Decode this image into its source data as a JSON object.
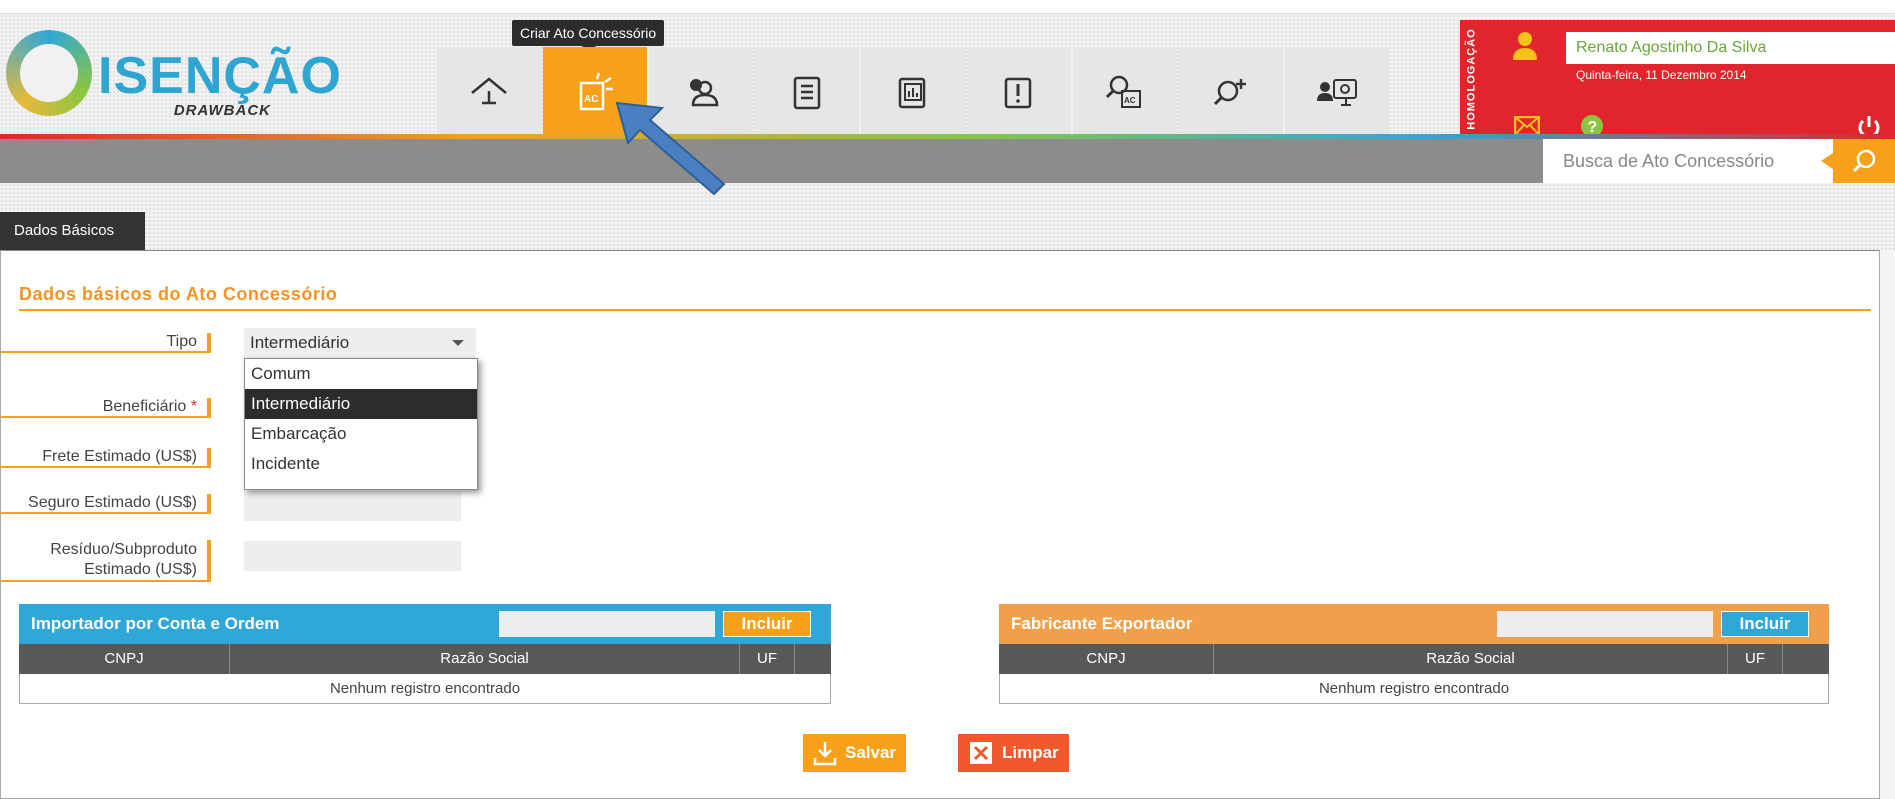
{
  "app": {
    "logo_title": "ISENÇÃO",
    "logo_sub": "DRAWBACK"
  },
  "nav": {
    "tooltip": "Criar Ato Concessório",
    "items": [
      {
        "icon": "home-icon"
      },
      {
        "icon": "criar-ato-icon",
        "active": true
      },
      {
        "icon": "users-icon"
      },
      {
        "icon": "clipboard-icon"
      },
      {
        "icon": "report-icon"
      },
      {
        "icon": "alert-doc-icon"
      },
      {
        "icon": "search-ac-icon"
      },
      {
        "icon": "search-plus-icon"
      },
      {
        "icon": "settings-user-icon"
      }
    ]
  },
  "env_badge": "HOMOLOGAÇÃO",
  "user": {
    "name": "Renato Agostinho Da Silva",
    "date": "Quinta-feira, 11 Dezembro 2014"
  },
  "search": {
    "placeholder": "Busca de Ato Concessório"
  },
  "tabs": [
    {
      "label": "Dados Básicos"
    }
  ],
  "form": {
    "section_title": "Dados básicos do Ato Concessório",
    "labels": {
      "tipo": "Tipo",
      "beneficiario": "Beneficiário",
      "beneficiario_required": "*",
      "frete": "Frete Estimado (US$)",
      "seguro": "Seguro Estimado (US$)",
      "residuo_line1": "Resíduo/Subproduto",
      "residuo_line2": "Estimado (US$)"
    },
    "tipo_selected": "Intermediário",
    "tipo_options": [
      "Comum",
      "Intermediário",
      "Embarcação",
      "Incidente"
    ]
  },
  "importador": {
    "title": "Importador por Conta e Ordem",
    "include_label": "Incluir",
    "columns": [
      "CNPJ",
      "Razão Social",
      "UF"
    ],
    "empty": "Nenhum registro encontrado"
  },
  "fabricante": {
    "title": "Fabricante Exportador",
    "include_label": "Incluir",
    "columns": [
      "CNPJ",
      "Razão Social",
      "UF"
    ],
    "empty": "Nenhum registro encontrado"
  },
  "actions": {
    "save_label": "Salvar",
    "clear_label": "Limpar"
  },
  "colors": {
    "accent_orange": "#f7a11a",
    "accent_blue": "#2fa8d8",
    "alert_red": "#e0262c",
    "clear_red": "#f1582c",
    "user_green": "#6aa83a"
  }
}
